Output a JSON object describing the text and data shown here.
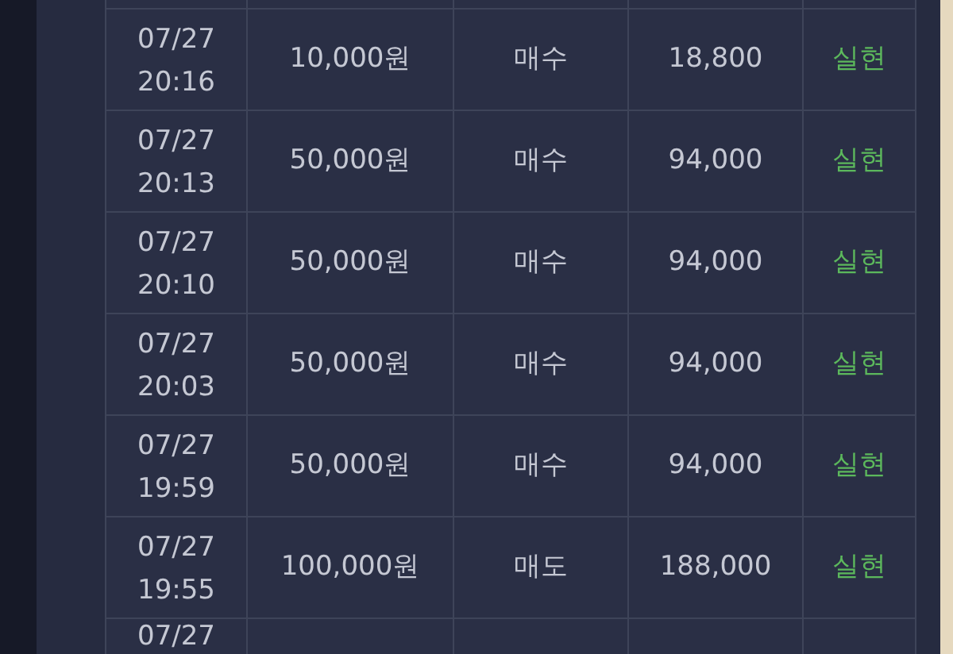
{
  "rows": [
    {
      "date": "07/27",
      "time": "20:16",
      "amount": "10,000원",
      "side": "매수",
      "price": "18,800",
      "status": "실현"
    },
    {
      "date": "07/27",
      "time": "20:13",
      "amount": "50,000원",
      "side": "매수",
      "price": "94,000",
      "status": "실현"
    },
    {
      "date": "07/27",
      "time": "20:10",
      "amount": "50,000원",
      "side": "매수",
      "price": "94,000",
      "status": "실현"
    },
    {
      "date": "07/27",
      "time": "20:03",
      "amount": "50,000원",
      "side": "매수",
      "price": "94,000",
      "status": "실현"
    },
    {
      "date": "07/27",
      "time": "19:59",
      "amount": "50,000원",
      "side": "매수",
      "price": "94,000",
      "status": "실현"
    },
    {
      "date": "07/27",
      "time": "19:55",
      "amount": "100,000원",
      "side": "매도",
      "price": "188,000",
      "status": "실현"
    },
    {
      "date": "07/27"
    }
  ]
}
